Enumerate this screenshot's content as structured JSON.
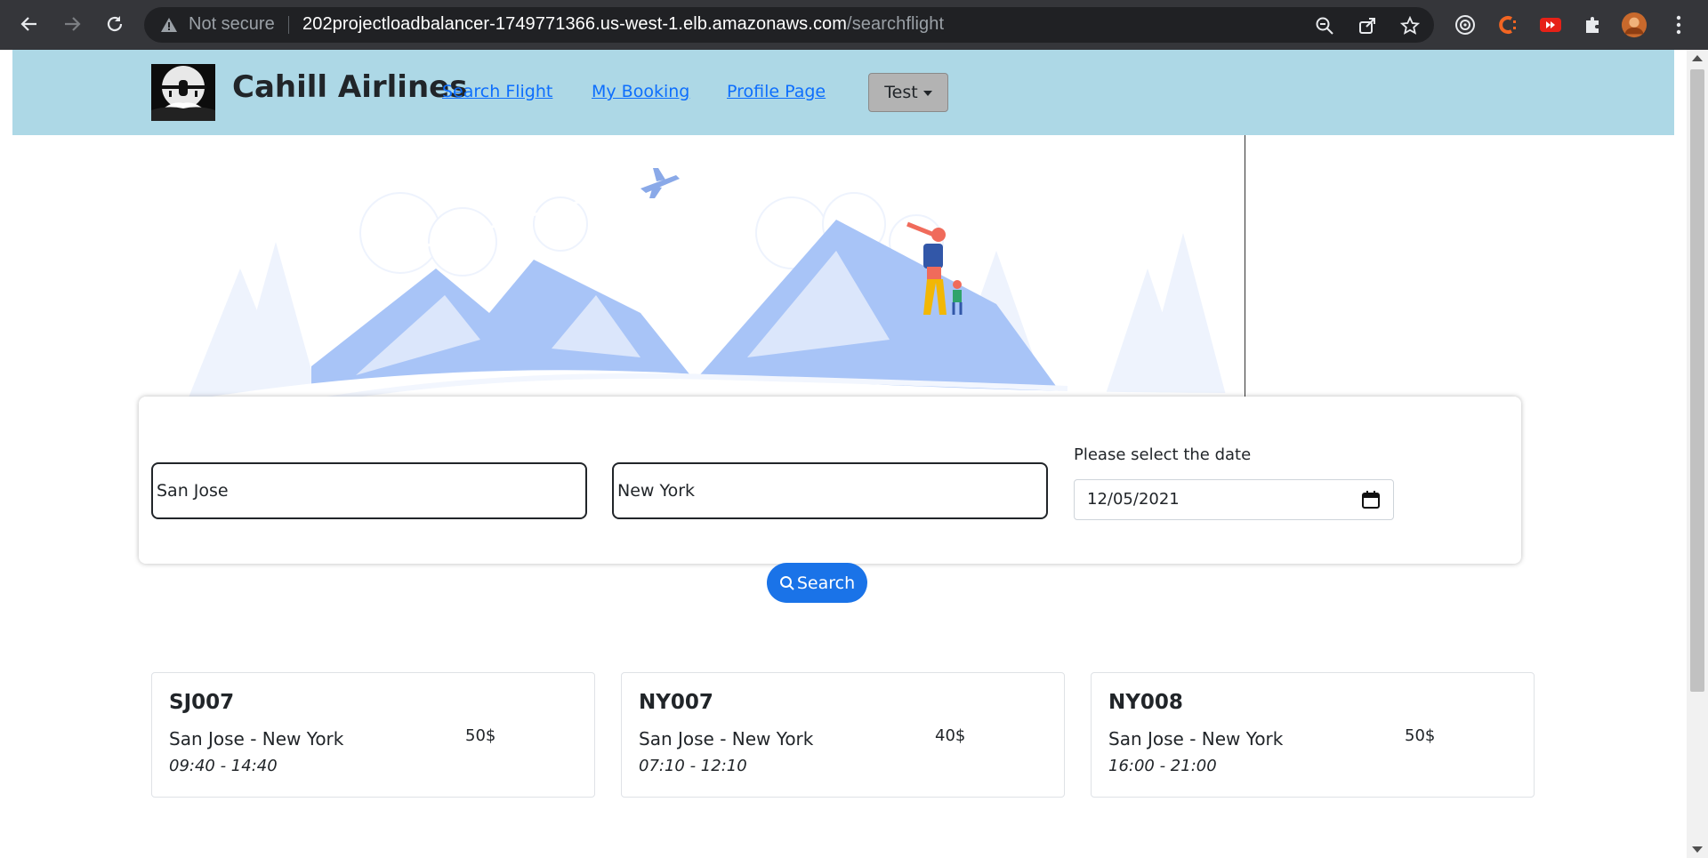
{
  "browser": {
    "security_label": "Not secure",
    "url_host": "202projectloadbalancer-1749771366.us-west-1.elb.amazonaws.com",
    "url_path": "/searchflight"
  },
  "header": {
    "brand": "Cahill Airlines",
    "nav": {
      "search_flight": "Search Flight",
      "my_booking": "My Booking",
      "profile_page": "Profile Page"
    },
    "user_menu_label": "Test",
    "background_color": "#add8e6"
  },
  "search": {
    "origin_value": "San Jose",
    "destination_value": "New York",
    "date_label": "Please select the date",
    "date_value": "12/05/2021",
    "button_label": "Search",
    "button_color": "#1a73e8"
  },
  "flights": [
    {
      "code": "SJ007",
      "route": "San Jose - New York",
      "price": "50$",
      "time": "09:40 - 14:40"
    },
    {
      "code": "NY007",
      "route": "San Jose - New York",
      "price": "40$",
      "time": "07:10 - 12:10"
    },
    {
      "code": "NY008",
      "route": "San Jose - New York",
      "price": "50$",
      "time": "16:00 - 21:00"
    }
  ],
  "icons": {
    "back": "arrow-left-icon",
    "forward": "arrow-right-icon",
    "reload": "reload-icon",
    "warning": "warning-icon",
    "zoom": "zoom-out-icon",
    "share": "share-icon",
    "bookmark": "star-icon",
    "calendar": "calendar-icon",
    "search": "search-icon"
  }
}
